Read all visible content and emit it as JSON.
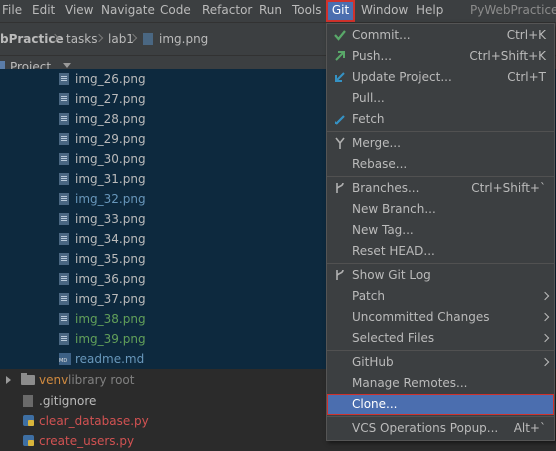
{
  "menubar": {
    "items": [
      "File",
      "Edit",
      "View",
      "Navigate",
      "Code",
      "Refactor",
      "Run",
      "Tools",
      "Git",
      "Window",
      "Help"
    ],
    "app_title": "PyWebPractice"
  },
  "breadcrumb": {
    "project": "bPractice",
    "folder1": "tasks",
    "folder2": "lab1",
    "file": "img.png"
  },
  "project_panel": {
    "title": "Project"
  },
  "tree": {
    "files": [
      {
        "name": "img_26.png",
        "color": "#bbbbbb"
      },
      {
        "name": "img_27.png",
        "color": "#bbbbbb"
      },
      {
        "name": "img_28.png",
        "color": "#bbbbbb"
      },
      {
        "name": "img_29.png",
        "color": "#bbbbbb"
      },
      {
        "name": "img_30.png",
        "color": "#bbbbbb"
      },
      {
        "name": "img_31.png",
        "color": "#bbbbbb"
      },
      {
        "name": "img_32.png",
        "color": "#6897bb"
      },
      {
        "name": "img_33.png",
        "color": "#bbbbbb"
      },
      {
        "name": "img_34.png",
        "color": "#bbbbbb"
      },
      {
        "name": "img_35.png",
        "color": "#bbbbbb"
      },
      {
        "name": "img_36.png",
        "color": "#bbbbbb"
      },
      {
        "name": "img_37.png",
        "color": "#bbbbbb"
      },
      {
        "name": "img_38.png",
        "color": "#62a05a"
      },
      {
        "name": "img_39.png",
        "color": "#62a05a"
      }
    ],
    "readme": "readme.md",
    "venv": "venv",
    "venv_hint": "library root",
    "gitignore": ".gitignore",
    "clear_db": "clear_database.py",
    "create_users": "create_users.py"
  },
  "git_menu": {
    "commit": "Commit...",
    "commit_sc": "Ctrl+K",
    "push": "Push...",
    "push_sc": "Ctrl+Shift+K",
    "update": "Update Project...",
    "update_sc": "Ctrl+T",
    "pull": "Pull...",
    "fetch": "Fetch",
    "merge": "Merge...",
    "rebase": "Rebase...",
    "branches": "Branches...",
    "branches_sc": "Ctrl+Shift+`",
    "new_branch": "New Branch...",
    "new_tag": "New Tag...",
    "reset_head": "Reset HEAD...",
    "show_log": "Show Git Log",
    "patch": "Patch",
    "uncommitted": "Uncommitted Changes",
    "selected_files": "Selected Files",
    "github": "GitHub",
    "manage_remotes": "Manage Remotes...",
    "clone": "Clone...",
    "vcs_popup": "VCS Operations Popup...",
    "vcs_popup_sc": "Alt+`"
  },
  "colors": {
    "accent": "#4b6eaf",
    "highlight_border": "#d0322c",
    "tree_selection": "#0d293e",
    "modified_blue": "#6897bb",
    "added_green": "#62a05a",
    "unversioned_red": "#d25252",
    "excluded_orange": "#d08a3f"
  }
}
